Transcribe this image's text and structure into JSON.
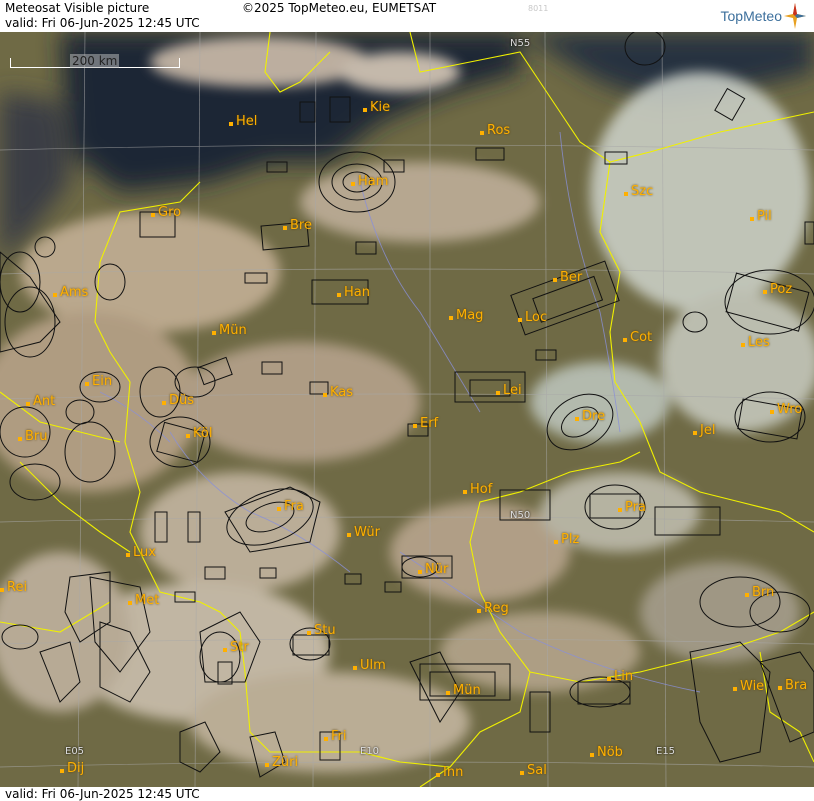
{
  "header": {
    "title": "Meteosat Visible picture",
    "valid": "valid:  Fri  06-Jun-2025  12:45 UTC",
    "copyright": "©2025 TopMeteo.eu, EUMETSAT",
    "frame_id": "8011",
    "logo_text": "TopMeteo"
  },
  "footer": {
    "valid": "valid:  Fri  06-Jun-2025  12:45 UTC"
  },
  "scale_label": "200 km",
  "grid_labels": [
    "N55",
    "N50",
    "E05",
    "E10",
    "E15"
  ],
  "cities": [
    "Hel",
    "Kie",
    "Ros",
    "Ham",
    "Szc",
    "Gro",
    "Bre",
    "Pil",
    "Ams",
    "Han",
    "Ber",
    "Poz",
    "Mün",
    "Mag",
    "Loc",
    "Cot",
    "Les",
    "Ein",
    "Kas",
    "Lei",
    "Ant",
    "Düs",
    "Bru",
    "Köl",
    "Erf",
    "Dre",
    "Wro",
    "Jel",
    "Hof",
    "Pra",
    "Fra",
    "Wür",
    "Plz",
    "Lux",
    "Nür",
    "Rei",
    "Met",
    "Brn",
    "Reg",
    "Stu",
    "Str",
    "Ulm",
    "Mün",
    "Lin",
    "Wie",
    "Bra",
    "Fri",
    "Züri",
    "Inn",
    "Sal",
    "Nöb",
    "Dij"
  ],
  "colors": {
    "sea": "#1a2433",
    "land": "#6f6a45",
    "border": "#f0f000",
    "river": "#8a90d8",
    "city": "#ffb000"
  }
}
